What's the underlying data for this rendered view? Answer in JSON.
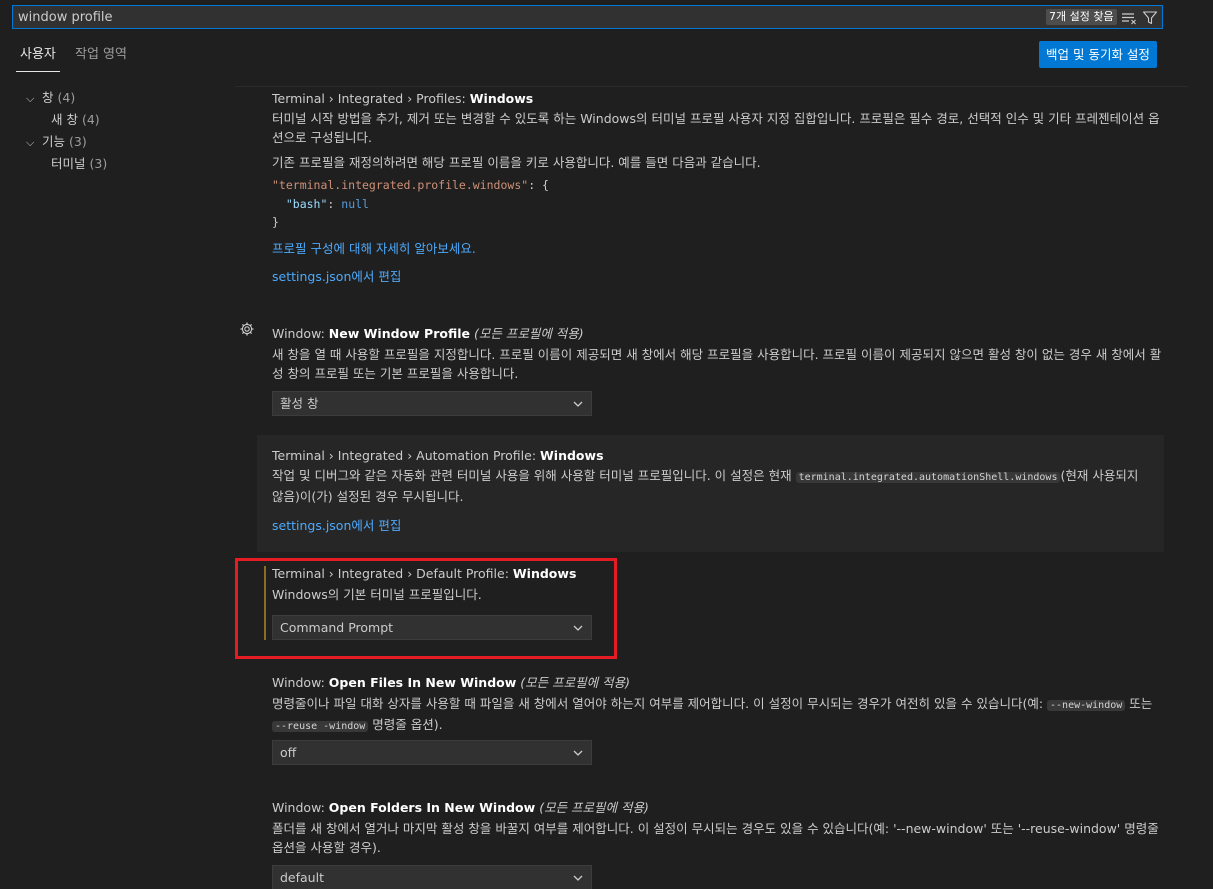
{
  "search": {
    "value": "window profile",
    "result_count": "7개 설정 찾음",
    "clear_icon": "clear-filter-icon",
    "filter_icon": "filter-icon"
  },
  "tabs": [
    {
      "label": "사용자",
      "active": true
    },
    {
      "label": "작업 영역",
      "active": false
    }
  ],
  "backup_button": {
    "label": "백업 및 동기화 설정",
    "color": "#0078d4"
  },
  "toc": [
    {
      "label": "창",
      "count": "(4)",
      "expanded": true,
      "level": 0
    },
    {
      "label": "새 창",
      "count": "(4)",
      "level": 1
    },
    {
      "label": "기능",
      "count": "(3)",
      "expanded": true,
      "level": 0
    },
    {
      "label": "터미널",
      "count": "(3)",
      "level": 1
    }
  ],
  "settings": {
    "profiles_windows": {
      "category": "Terminal › Integrated › Profiles: ",
      "key": "Windows",
      "desc1": "터미널 시작 방법을 추가, 제거 또는 변경할 수 있도록 하는 Windows의 터미널 프로필 사용자 지정 집합입니다. 프로필은 필수 경로, 선택적 인수 및 기타 프레젠테이션 옵션으로 구성됩니다.",
      "desc2": "기존 프로필을 재정의하려면 해당 프로필 이름을 키로 사용합니다. 예를 들면 다음과 같습니다.",
      "json_key": "\"terminal.integrated.profile.windows\"",
      "json_open": ": {",
      "json_inner_key": "\"bash\"",
      "json_inner_sep": ": ",
      "json_null": "null",
      "json_close": "}",
      "link1": "프로필 구성에 대해 자세히 알아보세요.",
      "link2": "settings.json에서 편집"
    },
    "new_window_profile": {
      "category": "Window: ",
      "key": "New Window Profile",
      "scope": "(모든 프로필에 적용)",
      "desc": "새 창을 열 때 사용할 프로필을 지정합니다. 프로필 이름이 제공되면 새 창에서 해당 프로필을 사용합니다. 프로필 이름이 제공되지 않으면 활성 창이 없는 경우 새 창에서 활성 창의 프로필 또는 기본 프로필을 사용합니다.",
      "value": "활성 창"
    },
    "automation_profile": {
      "category": "Terminal › Integrated › Automation Profile: ",
      "key": "Windows",
      "desc_before": "작업 및 디버그와 같은 자동화 관련 터미널 사용을 위해 사용할 터미널 프로필입니다. 이 설정은 현재 ",
      "desc_code": "terminal.integrated.automationShell.windows",
      "desc_after": "(현재 사용되지 않음)이(가) 설정된 경우 무시됩니다.",
      "link": "settings.json에서 편집"
    },
    "default_profile": {
      "category": "Terminal › Integrated › Default Profile: ",
      "key": "Windows",
      "desc": "Windows의 기본 터미널 프로필입니다.",
      "value": "Command Prompt"
    },
    "open_files": {
      "category": "Window: ",
      "key": "Open Files In New Window",
      "scope": "(모든 프로필에 적용)",
      "desc_before": "명령줄이나 파일 대화 상자를 사용할 때 파일을 새 창에서 열어야 하는지 여부를 제어합니다. 이 설정이 무시되는 경우가 여전히 있을 수 있습니다(예: ",
      "code1": "--new-window",
      "desc_mid": " 또는 ",
      "code2": "--reuse -window",
      "desc_after": " 명령줄 옵션).",
      "value": "off"
    },
    "open_folders": {
      "category": "Window: ",
      "key": "Open Folders In New Window",
      "scope": "(모든 프로필에 적용)",
      "desc": "폴더를 새 창에서 열거나 마지막 활성 창을 바꿀지 여부를 제어합니다. 이 설정이 무시되는 경우도 있을 수 있습니다(예: '--new-window' 또는 '--reuse-window' 명령줄 옵션을 사용할 경우).",
      "value": "default"
    }
  },
  "colors": {
    "accent": "#0078d4",
    "highlight_box": "#e51c23",
    "link": "#4daafc"
  }
}
